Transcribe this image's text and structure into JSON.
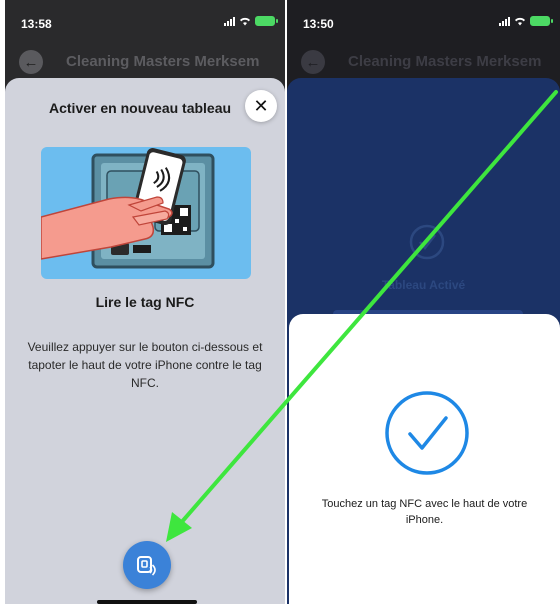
{
  "left_screen": {
    "status_time": "13:58",
    "nav_title": "Cleaning Masters Merksem",
    "sheet": {
      "title": "Activer en nouveau tableau",
      "close_icon": "close-icon",
      "heading": "Lire le tag NFC",
      "body": "Veuillez appuyer sur le bouton ci-dessous et tapoter le haut de votre iPhone contre le tag NFC.",
      "fab_icon": "nfc-scan-icon"
    }
  },
  "right_screen": {
    "status_time": "13:50",
    "nav_title": "Cleaning Masters Merksem",
    "activated_label": "Tableau Activé",
    "scan_prompt": "Touchez un tag NFC avec le haut de votre iPhone."
  },
  "colors": {
    "fab_blue": "#3b82d8",
    "dark_sheet": "#1b3266",
    "check_blue": "#1e88e5",
    "arrow_green": "#3ee63e"
  }
}
